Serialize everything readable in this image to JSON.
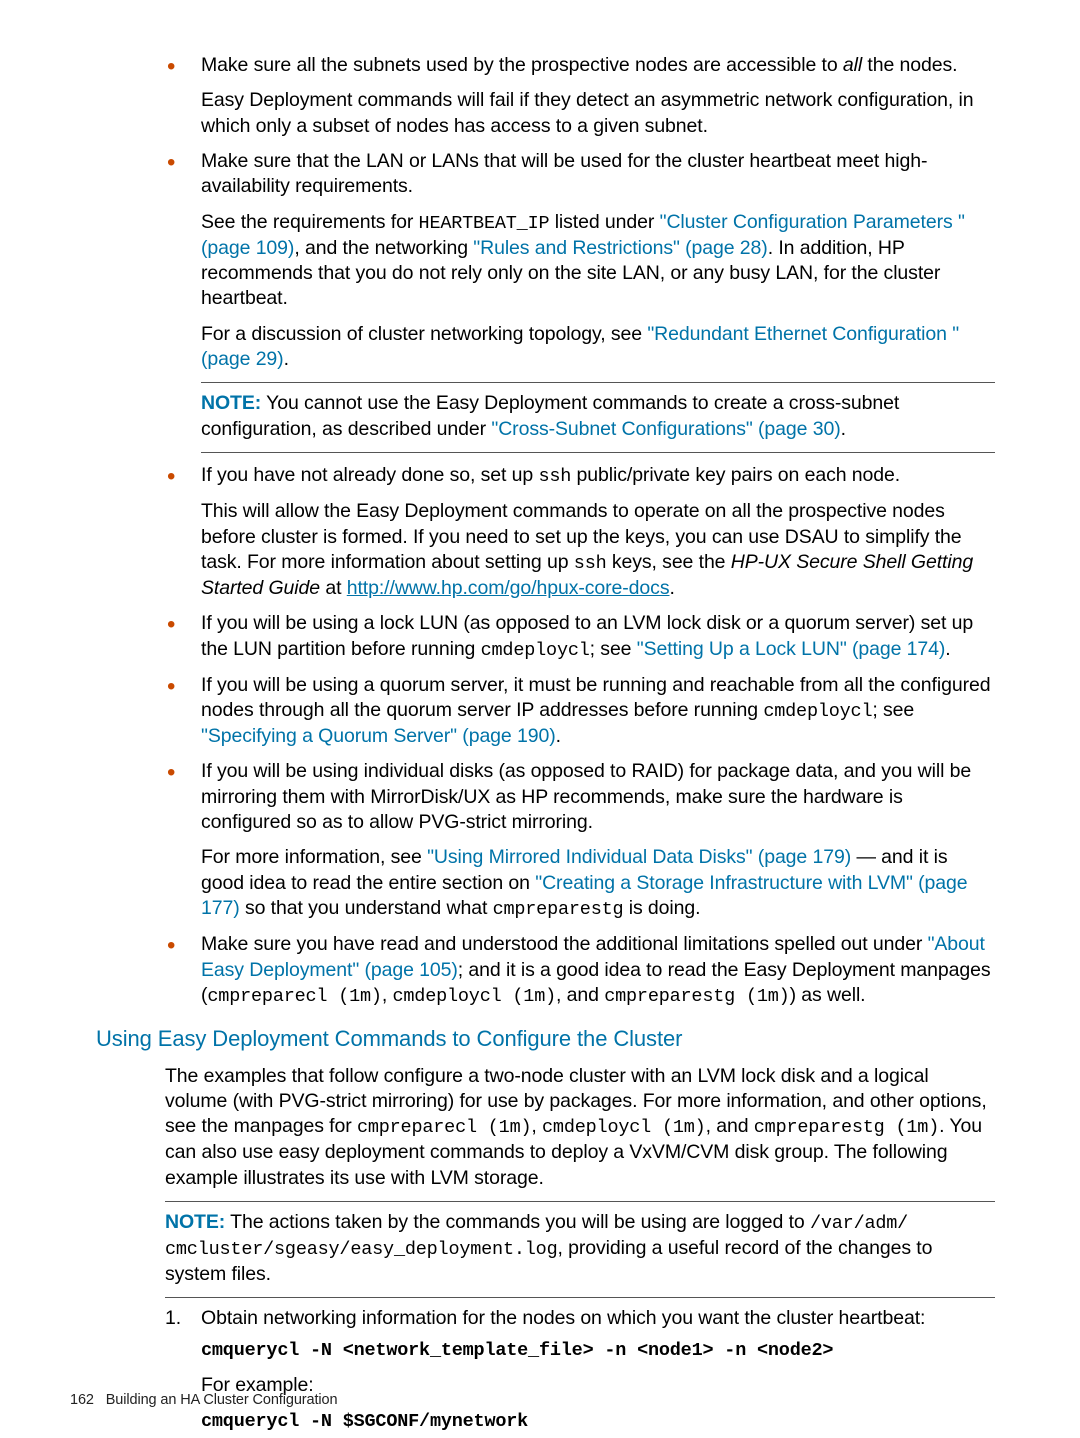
{
  "bullets": [
    {
      "main": "Make sure all the subnets used by the prospective nodes are accessible to ",
      "italic": "all",
      "tail": " the nodes.",
      "sub1a": "Easy Deployment commands will fail if they detect an asymmetric network configuration, in which only a subset of nodes has access to a given subnet."
    },
    {
      "main": "Make sure that the LAN or LANs that will be used for the cluster heartbeat meet high-availability requirements.",
      "sub2a_pre": "See the requirements for ",
      "sub2a_mono": "HEARTBEAT_IP",
      "sub2a_mid": " listed under ",
      "sub2a_link1": "\"Cluster Configuration Parameters \" (page 109)",
      "sub2a_mid2": ", and the networking ",
      "sub2a_link2": "\"Rules and Restrictions\" (page 28)",
      "sub2a_tail": ". In addition, HP recommends that you do not rely only on the site LAN, or any busy LAN, for the cluster heartbeat.",
      "sub2b_pre": "For a discussion of cluster networking topology, see ",
      "sub2b_link": "\"Redundant Ethernet Configuration \" (page 29)",
      "sub2b_tail": ".",
      "note_label": "NOTE:",
      "note_body_pre": "   You cannot use the Easy Deployment commands to create a cross-subnet configuration, as described under ",
      "note_link": "\"Cross-Subnet Configurations\" (page 30)",
      "note_tail": "."
    },
    {
      "main_pre": "If you have not already done so, set up ",
      "main_mono": "ssh",
      "main_tail": " public/private key pairs on each node.",
      "sub3a_pre": "This will allow the Easy Deployment commands to operate on all the prospective nodes before cluster is formed. If you need to set up the keys, you can use DSAU to simplify the task. For more information about setting up ",
      "sub3a_mono": "ssh",
      "sub3a_mid": " keys, see the ",
      "sub3a_italic": "HP-UX Secure Shell Getting Started Guide",
      "sub3a_at": " at ",
      "sub3a_url": "http://www.hp.com/go/hpux-core-docs",
      "sub3a_tail": "."
    },
    {
      "main4_pre": "If you will be using a lock LUN (as opposed to an LVM lock disk or a quorum server) set up the LUN partition before running ",
      "main4_mono": "cmdeploycl",
      "main4_mid": "; see ",
      "main4_link": "\"Setting Up a Lock LUN\" (page 174)",
      "main4_tail": "."
    },
    {
      "main5_pre": "If you will be using a quorum server, it must be running and reachable from all the configured nodes through all the quorum server IP addresses before running ",
      "main5_mono": "cmdeploycl",
      "main5_mid": "; see ",
      "main5_link": "\"Specifying a Quorum Server\" (page 190)",
      "main5_tail": "."
    },
    {
      "main6": "If you will be using individual disks (as opposed to RAID) for package data, and you will be mirroring them with MirrorDisk/UX as HP recommends, make sure the hardware is configured so as to allow PVG-strict mirroring.",
      "sub6a_pre": "For more information, see ",
      "sub6a_link1": "\"Using Mirrored Individual Data Disks\" (page 179)",
      "sub6a_mid": " — and it is good idea to read the entire section on ",
      "sub6a_link2": "\"Creating a Storage Infrastructure with LVM\" (page 177)",
      "sub6a_mid2": " so that you understand what ",
      "sub6a_mono": "cmpreparestg",
      "sub6a_tail": " is doing."
    },
    {
      "main7_pre": "Make sure you have read and understood the additional limitations spelled out under ",
      "main7_link": "\"About Easy Deployment\" (page 105)",
      "main7_mid": "; and it is a good idea to read the Easy Deployment manpages (",
      "main7_mono1": "cmpreparecl (1m)",
      "main7_c1": ", ",
      "main7_mono2": "cmdeploycl (1m)",
      "main7_c2": ", and ",
      "main7_mono3": "cmpreparestg (1m)",
      "main7_tail": ") as well."
    }
  ],
  "heading": "Using Easy Deployment Commands to Configure the Cluster",
  "para1_pre": "The examples that follow configure a two-node cluster with an LVM lock disk and a logical volume (with PVG-strict mirroring) for use by packages. For more information, and other options, see the manpages for ",
  "para1_m1": "cmpreparecl (1m)",
  "para1_c1": ", ",
  "para1_m2": "cmdeploycl (1m)",
  "para1_c2": ", and ",
  "para1_m3": "cmpreparestg (1m)",
  "para1_tail": ". You can also use easy deployment commands to deploy a VxVM/CVM disk group. The following example illustrates its use with LVM storage.",
  "note2_label": "NOTE:",
  "note2_pre": "   The actions taken by the commands you will be using are logged to ",
  "note2_mono1": "/var/adm/",
  "note2_mono2": "cmcluster/sgeasy/easy_deployment.log",
  "note2_tail": ", providing a useful record of the changes to system files.",
  "step_num": "1.",
  "step_text": "Obtain networking information for the nodes on which you want the cluster heartbeat:",
  "cmd1": "cmquerycl -N <network_template_file> -n <node1> -n <node2>",
  "for_example": "For example:",
  "cmd2": "cmquerycl -N $SGCONF/mynetwork",
  "footer_page": "162",
  "footer_text": "Building an HA Cluster Configuration"
}
